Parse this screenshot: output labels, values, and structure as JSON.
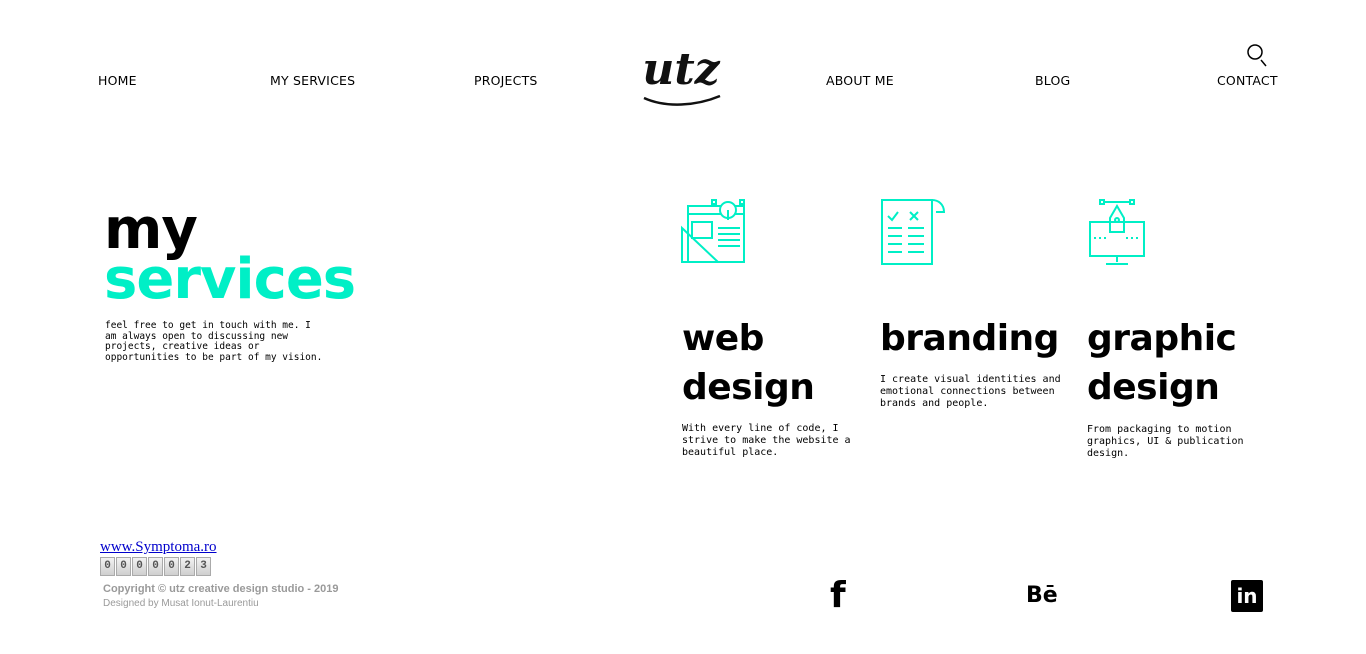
{
  "nav": {
    "home": "HOME",
    "services": "MY SERVICES",
    "projects": "PROJECTS",
    "about": "ABOUT ME",
    "blog": "BLOG",
    "contact": "CONTACT",
    "logo_text": "utz"
  },
  "hero": {
    "line1": "my",
    "line2": "services",
    "description": "feel free to get in touch with me. I am always open to discussing new projects, creative ideas or opportunities to be part of my vision."
  },
  "services": [
    {
      "title_line1": "web",
      "title_line2": "design",
      "description": "With every line of code, I strive to make the website a beautiful place.",
      "icon": "web-design-icon"
    },
    {
      "title_line1": "branding",
      "title_line2": "",
      "description": "I create visual identities and emotional connections between brands and people.",
      "icon": "branding-icon"
    },
    {
      "title_line1": "graphic",
      "title_line2": "design",
      "description": "From packaging to motion graphics, UI & publication design.",
      "icon": "graphic-design-icon"
    }
  ],
  "footer": {
    "counter_link": "www.Symptoma.ro",
    "counter_digits": [
      "0",
      "0",
      "0",
      "0",
      "0",
      "2",
      "3"
    ],
    "copyright": "Copyright © utz creative design studio - 2019",
    "designed_by": "Designed by Musat Ionut-Laurentiu",
    "social": {
      "facebook": "f",
      "behance": "Bē",
      "linkedin": "in"
    }
  },
  "colors": {
    "accent": "#00efc6",
    "text": "#000000",
    "muted": "#9a9a9a"
  }
}
